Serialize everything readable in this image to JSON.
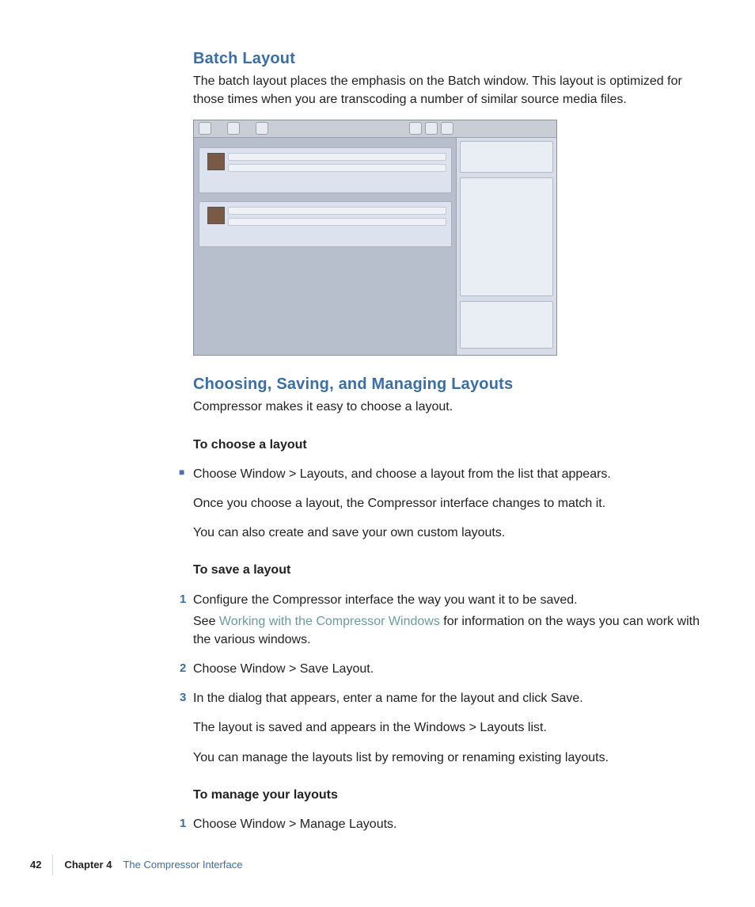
{
  "s1": {
    "heading": "Batch Layout",
    "para": "The batch layout places the emphasis on the Batch window. This layout is optimized for those times when you are transcoding a number of similar source media files."
  },
  "s2": {
    "heading": "Choosing, Saving, and Managing Layouts",
    "intro": "Compressor makes it easy to choose a layout.",
    "choose_h": "To choose a layout",
    "choose_b1": "Choose Window > Layouts, and choose a layout from the list that appears.",
    "choose_p1": "Once you choose a layout, the Compressor interface changes to match it.",
    "choose_p2": "You can also create and save your own custom layouts.",
    "save_h": "To save a layout",
    "save_s1": "Configure the Compressor interface the way you want it to be saved.",
    "save_s1b_pre": "See ",
    "save_s1b_link": "Working with the Compressor Windows",
    "save_s1b_post": " for information on the ways you can work with the various windows.",
    "save_s2": "Choose Window > Save Layout.",
    "save_s3": "In the dialog that appears, enter a name for the layout and click Save.",
    "save_p1": "The layout is saved and appears in the Windows > Layouts list.",
    "save_p2": "You can manage the layouts list by removing or renaming existing layouts.",
    "manage_h": "To manage your layouts",
    "manage_s1": "Choose Window > Manage Layouts."
  },
  "steps": {
    "n1": "1",
    "n2": "2",
    "n3": "3"
  },
  "bullet": "■",
  "footer": {
    "page": "42",
    "chapter": "Chapter 4",
    "title": "The Compressor Interface"
  }
}
